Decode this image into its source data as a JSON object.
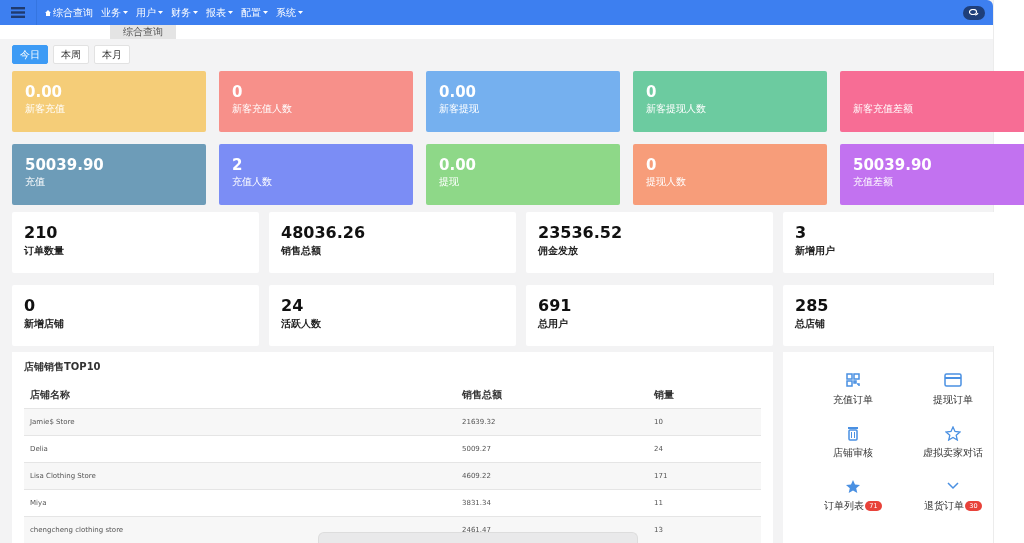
{
  "navbar": {
    "items": [
      {
        "label": "综合查询",
        "kind": "home"
      },
      {
        "label": "业务",
        "kind": "dropdown"
      },
      {
        "label": "用户",
        "kind": "dropdown"
      },
      {
        "label": "财务",
        "kind": "dropdown"
      },
      {
        "label": "报表",
        "kind": "dropdown"
      },
      {
        "label": "配置",
        "kind": "dropdown"
      },
      {
        "label": "系统",
        "kind": "dropdown"
      }
    ]
  },
  "page_tabs": [
    {
      "label": "综合查询",
      "selected": true
    }
  ],
  "period_buttons": [
    {
      "label": "今日",
      "selected": true
    },
    {
      "label": "本周",
      "selected": false
    },
    {
      "label": "本月",
      "selected": false
    }
  ],
  "color_cards": [
    {
      "value": "0.00",
      "label": "新客充值",
      "color": "#f5cd78"
    },
    {
      "value": "0",
      "label": "新客充值人数",
      "color": "#f7908a"
    },
    {
      "value": "0.00",
      "label": "新客提现",
      "color": "#75b0ef"
    },
    {
      "value": "0",
      "label": "新客提现人数",
      "color": "#6ccba0"
    },
    {
      "label": "新客充值差额",
      "color": "#f76d95"
    },
    {
      "value": "50039.90",
      "label": "充值",
      "color": "#6d9cb8"
    },
    {
      "value": "2",
      "label": "充值人数",
      "color": "#7b8df5"
    },
    {
      "value": "0.00",
      "label": "提现",
      "color": "#8ed888"
    },
    {
      "value": "0",
      "label": "提现人数",
      "color": "#f79d7a"
    },
    {
      "value": "50039.90",
      "label": "充值差额",
      "color": "#c272f0"
    }
  ],
  "stat_cards": [
    {
      "value": "210",
      "label": "订单数量"
    },
    {
      "value": "48036.26",
      "label": "销售总额"
    },
    {
      "value": "23536.52",
      "label": "佣金发放"
    },
    {
      "value": "3",
      "label": "新增用户"
    },
    {
      "value": "0",
      "label": "新增店铺"
    },
    {
      "value": "24",
      "label": "活跃人数"
    },
    {
      "value": "691",
      "label": "总用户"
    },
    {
      "value": "285",
      "label": "总店铺"
    }
  ],
  "top_stores": {
    "title": "店铺销售TOP10",
    "columns": [
      "店铺名称",
      "销售总额",
      "销量"
    ],
    "rows": [
      [
        "Jamie$ Store",
        "21639.32",
        "10"
      ],
      [
        "Delia",
        "5009.27",
        "24"
      ],
      [
        "Lisa Clothing Store",
        "4609.22",
        "171"
      ],
      [
        "Miya",
        "3831.34",
        "11"
      ],
      [
        "chengcheng clothing store",
        "2461.47",
        "13"
      ]
    ]
  },
  "shortcuts": [
    {
      "label": "充值订单",
      "kind": "qr"
    },
    {
      "label": "提现订单",
      "kind": "card"
    },
    {
      "label": "店铺审核",
      "kind": "trash"
    },
    {
      "label": "虚拟卖家对话",
      "kind": "star-outline"
    },
    {
      "label": "订单列表",
      "kind": "star",
      "badge": "71"
    },
    {
      "label": "退货订单",
      "kind": "chevron",
      "badge": "30"
    }
  ]
}
